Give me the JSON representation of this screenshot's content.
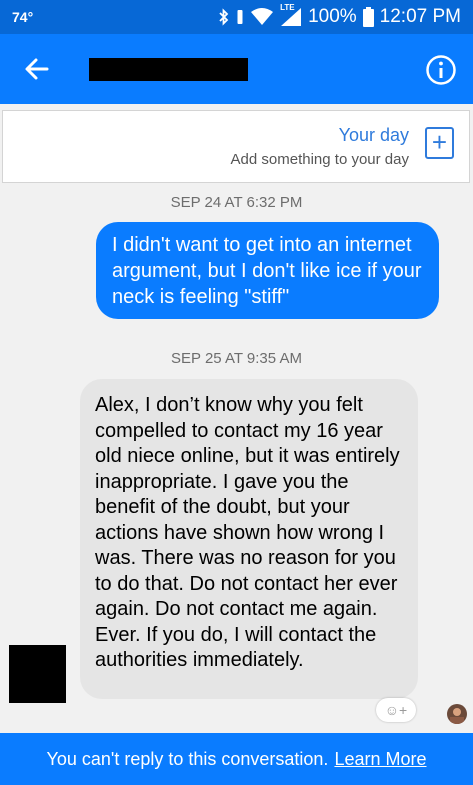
{
  "status_bar": {
    "temperature": "74°",
    "battery": "100%",
    "time": "12:07 PM",
    "network_label": "LTE"
  },
  "header": {
    "contact_name_redacted": true
  },
  "your_day": {
    "title": "Your day",
    "subtitle": "Add something to your day",
    "plus": "+"
  },
  "messages": [
    {
      "timestamp": "SEP 24 AT 6:32 PM",
      "direction": "outgoing",
      "text": "I didn't want to get into an internet argument, but I don't like ice if your neck is feeling \"stiff\""
    },
    {
      "timestamp": "SEP 25 AT 9:35 AM",
      "direction": "incoming",
      "text": "Alex, I don’t know why you felt compelled to contact my 16 year old niece online, but it was entirely inappropriate.  I gave you the benefit of the doubt, but your actions have shown how wrong I was. There was no reason for you to do that. Do not contact her ever again. Do not contact me again.  Ever. If you do, I will contact the authorities immediately."
    }
  ],
  "reaction_button": {
    "label": "☺+"
  },
  "footer": {
    "text": "You can't reply to this conversation.",
    "link": "Learn More"
  },
  "colors": {
    "brand": "#0a7cff",
    "status_bar": "#0768d6",
    "incoming_bubble": "#e5e5e5",
    "background": "#f1f1f1"
  }
}
